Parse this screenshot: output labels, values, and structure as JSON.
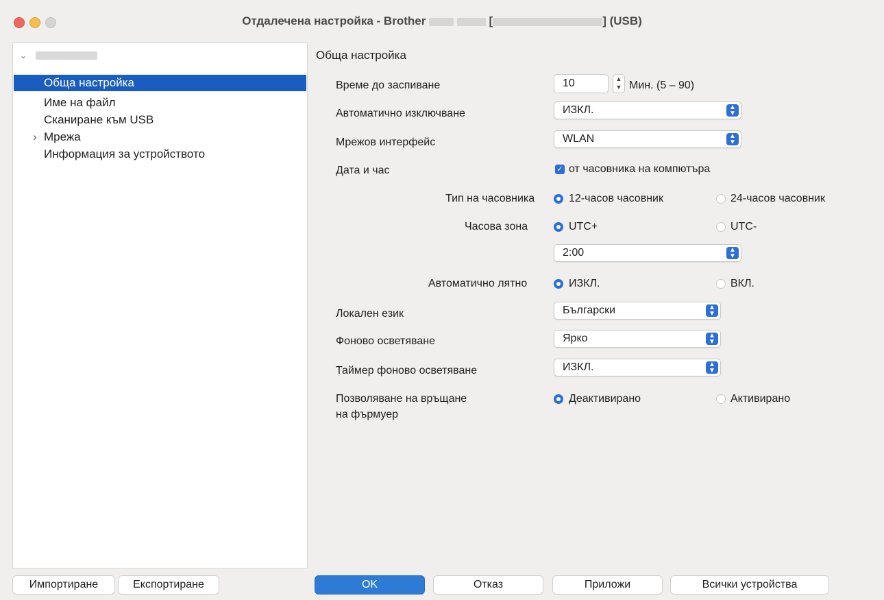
{
  "window": {
    "title_prefix": "Отдалечена настройка - Brother",
    "title_suffix": "] (USB)",
    "title_bracket": "["
  },
  "sidebar": {
    "items": [
      {
        "label": "Обща настройка",
        "selected": true
      },
      {
        "label": "Име на файл"
      },
      {
        "label": "Сканиране към USB"
      },
      {
        "label": "Мрежа",
        "expandable": true
      },
      {
        "label": "Информация за устройството"
      }
    ],
    "import_label": "Импортиране",
    "export_label": "Експортиране"
  },
  "main": {
    "section_title": "Обща настройка",
    "sleep_time": {
      "label": "Време до заспиване",
      "value": "10",
      "unit": "Мин. (5 – 90)"
    },
    "auto_power_off": {
      "label": "Автоматично изключване",
      "value": "ИЗКЛ."
    },
    "network_interface": {
      "label": "Мрежов интерфейс",
      "value": "WLAN"
    },
    "date_time": {
      "label": "Дата и час",
      "checkbox_label": "от часовника на компютъра",
      "checked": true
    },
    "clock_type": {
      "label": "Тип на часовника",
      "option1": "12-часов часовник",
      "option2": "24-часов часовник",
      "selected": 1
    },
    "time_zone": {
      "label": "Часова зона",
      "option1": "UTC+",
      "option2": "UTC-",
      "selected": 1,
      "value": "2:00"
    },
    "dst": {
      "label": "Автоматично лятно",
      "option1": "ИЗКЛ.",
      "option2": "ВКЛ.",
      "selected": 1
    },
    "local_language": {
      "label": "Локален език",
      "value": "Български"
    },
    "backlight": {
      "label": "Фоново осветяване",
      "value": "Ярко"
    },
    "backlight_timer": {
      "label": "Таймер фоново осветяване",
      "value": "ИЗКЛ."
    },
    "firmware_rollback": {
      "label_line1": "Позволяване на връщане",
      "label_line2": "на фърмуер",
      "option1": "Деактивирано",
      "option2": "Активирано",
      "selected": 1
    }
  },
  "buttons": {
    "ok": "OK",
    "cancel": "Отказ",
    "apply": "Приложи",
    "all_devices": "Всички устройства"
  },
  "colors": {
    "accent": "#2b6fd7",
    "selection": "#1a5dc0",
    "window_bg": "#f0efee"
  }
}
